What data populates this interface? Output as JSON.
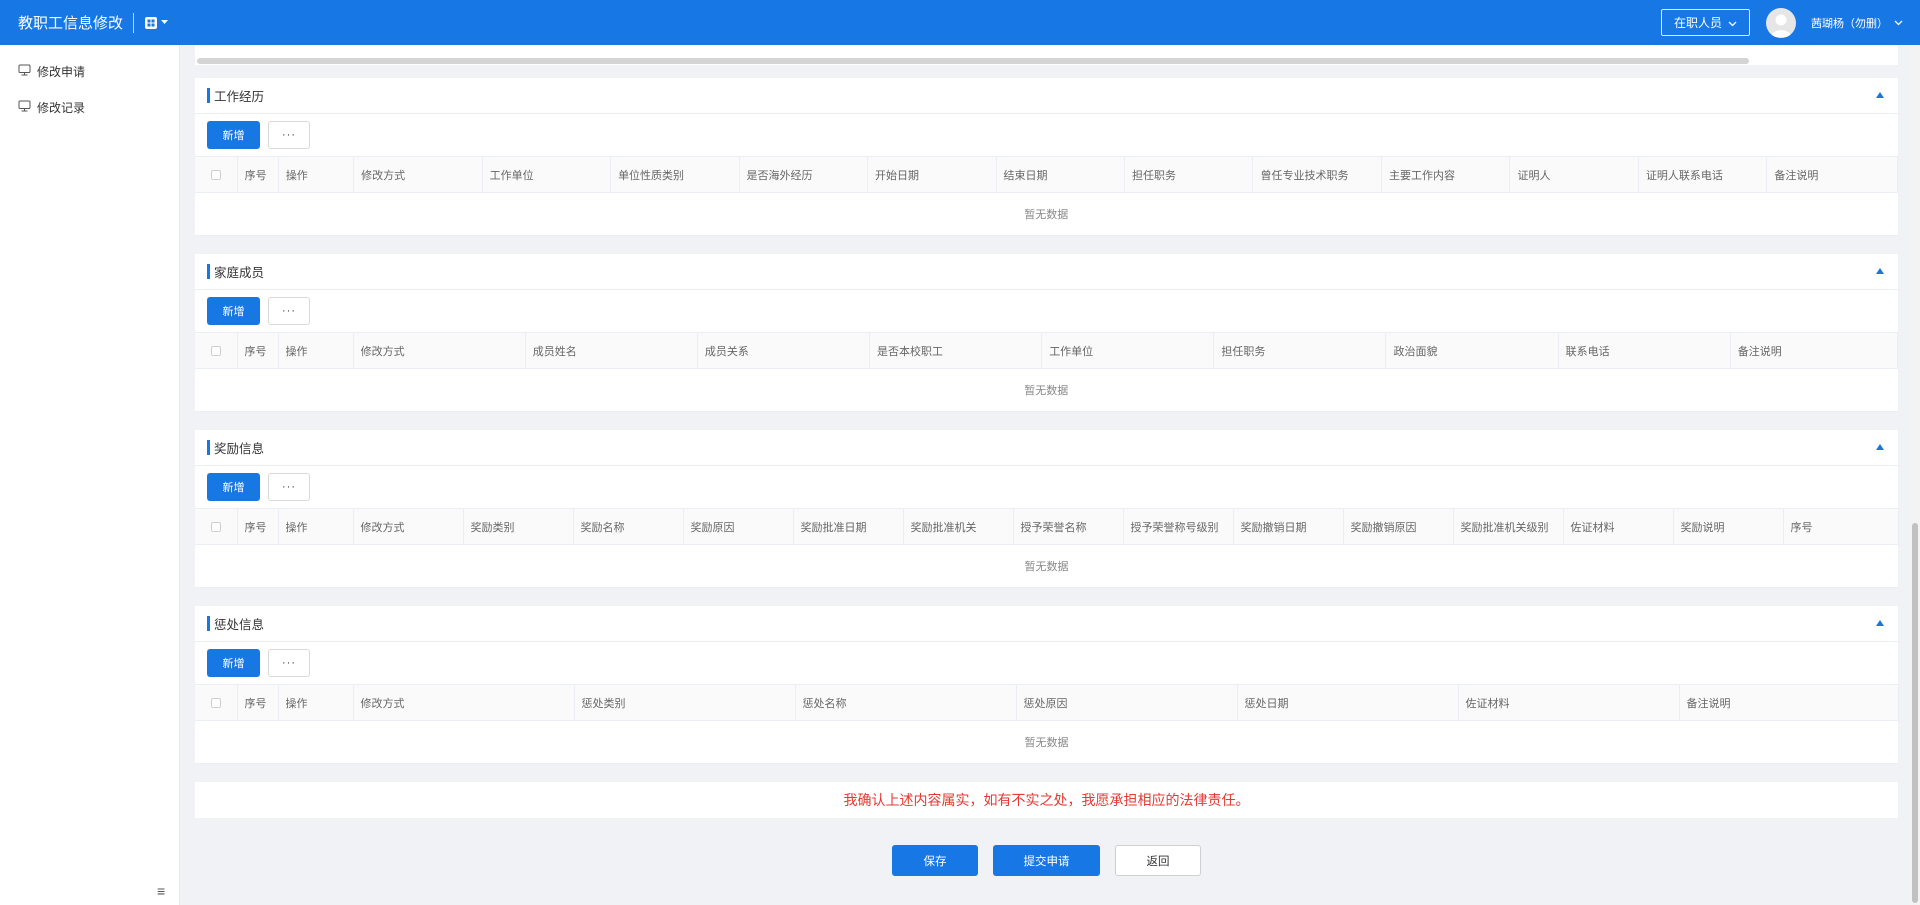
{
  "header": {
    "title": "教职工信息修改",
    "status_select": "在职人员",
    "user_name": "茜瑚杨（勿删）"
  },
  "sidebar": {
    "items": [
      {
        "label": "修改申请",
        "icon": "monitor-icon"
      },
      {
        "label": "修改记录",
        "icon": "monitor-icon"
      }
    ]
  },
  "common": {
    "add_label": "新增",
    "more_label": "···",
    "empty_text": "暂无数据"
  },
  "sections": [
    {
      "title": "工作经历",
      "columns": [
        "序号",
        "操作",
        "修改方式",
        "工作单位",
        "单位性质类别",
        "是否海外经历",
        "开始日期",
        "结束日期",
        "担任职务",
        "曾任专业技术职务",
        "主要工作内容",
        "证明人",
        "证明人联系电话",
        "备注说明"
      ]
    },
    {
      "title": "家庭成员",
      "columns": [
        "序号",
        "操作",
        "修改方式",
        "成员姓名",
        "成员关系",
        "是否本校职工",
        "工作单位",
        "担任职务",
        "政治面貌",
        "联系电话",
        "备注说明"
      ]
    },
    {
      "title": "奖励信息",
      "columns": [
        "序号",
        "操作",
        "修改方式",
        "奖励类别",
        "奖励名称",
        "奖励原因",
        "奖励批准日期",
        "奖励批准机关",
        "授予荣誉名称",
        "授予荣誉称号级别",
        "奖励撤销日期",
        "奖励撤销原因",
        "奖励批准机关级别",
        "佐证材料",
        "奖励说明",
        "序号"
      ]
    },
    {
      "title": "惩处信息",
      "columns": [
        "序号",
        "操作",
        "修改方式",
        "惩处类别",
        "惩处名称",
        "惩处原因",
        "惩处日期",
        "佐证材料",
        "备注说明"
      ]
    }
  ],
  "confirm_text": "我确认上述内容属实，如有不实之处，我愿承担相应的法律责任。",
  "actions": {
    "save": "保存",
    "submit": "提交申请",
    "back": "返回"
  },
  "colors": {
    "primary": "#1677e5",
    "warning_text": "#e53935"
  }
}
